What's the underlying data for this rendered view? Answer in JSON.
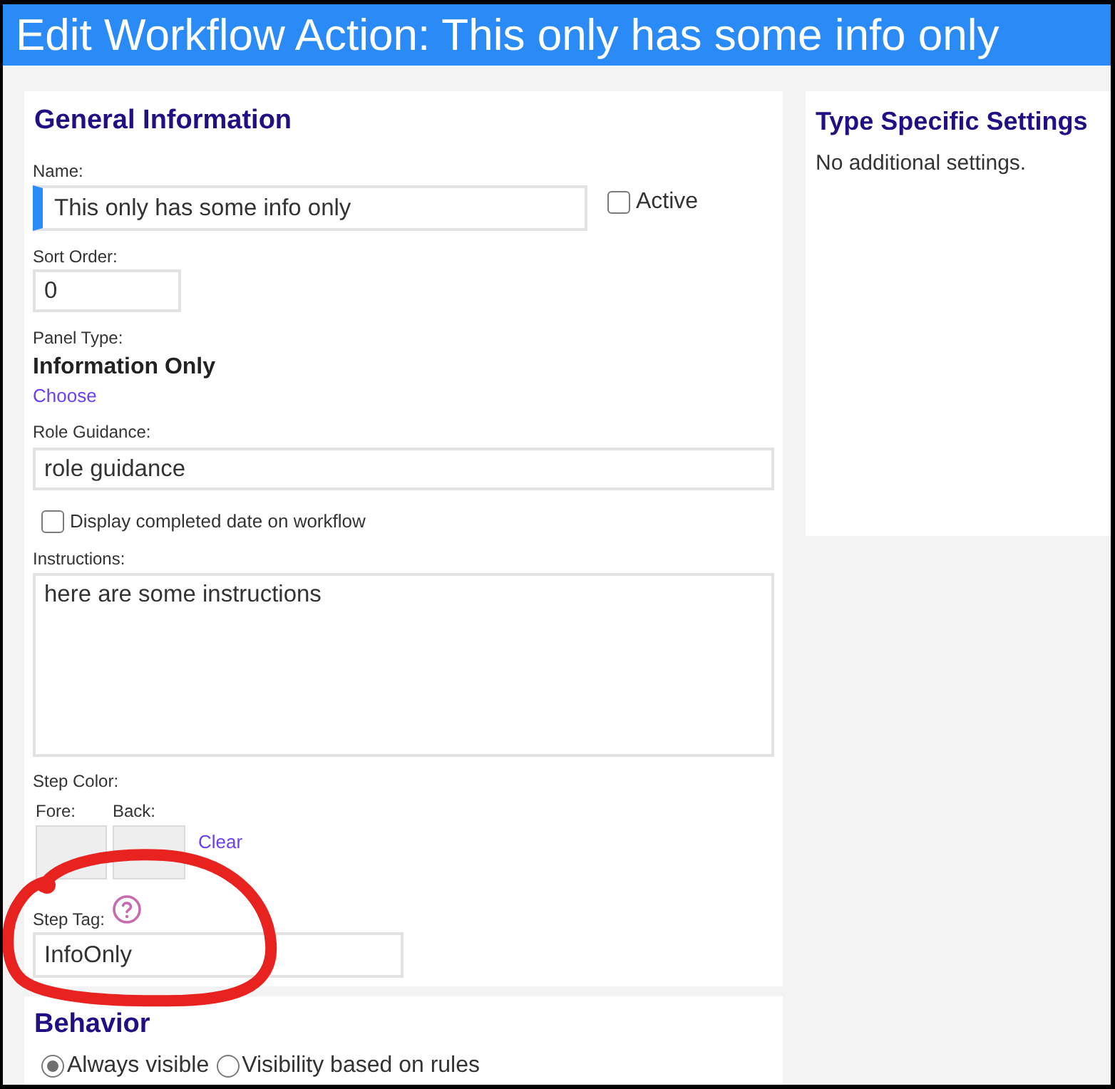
{
  "window": {
    "title": "Edit Workflow Action: This only has some info only"
  },
  "general_information": {
    "heading": "General Information",
    "name": {
      "label": "Name:",
      "value": "This only has some info only",
      "required": true
    },
    "active": {
      "label": "Active",
      "checked": false
    },
    "sort_order": {
      "label": "Sort Order:",
      "value": "0"
    },
    "panel_type": {
      "label": "Panel Type:",
      "value": "Information Only",
      "link": "Choose"
    },
    "role_guidance": {
      "label": "Role Guidance:",
      "value": "role guidance"
    },
    "display_completed_date": {
      "label": "Display completed date on workflow",
      "checked": false
    },
    "instructions": {
      "label": "Instructions:",
      "value": "here are some instructions"
    },
    "step_color": {
      "label": "Step Color:",
      "fore_label": "Fore:",
      "back_label": "Back:",
      "clear_link": "Clear"
    },
    "step_tag": {
      "label": "Step Tag:",
      "value": "InfoOnly",
      "highlighted": true
    }
  },
  "behavior": {
    "heading": "Behavior",
    "options": [
      {
        "label": "Always visible",
        "selected": true
      },
      {
        "label": "Visibility based on rules",
        "selected": false
      }
    ]
  },
  "type_specific_settings": {
    "heading": "Type Specific Settings",
    "text": "No additional settings."
  }
}
